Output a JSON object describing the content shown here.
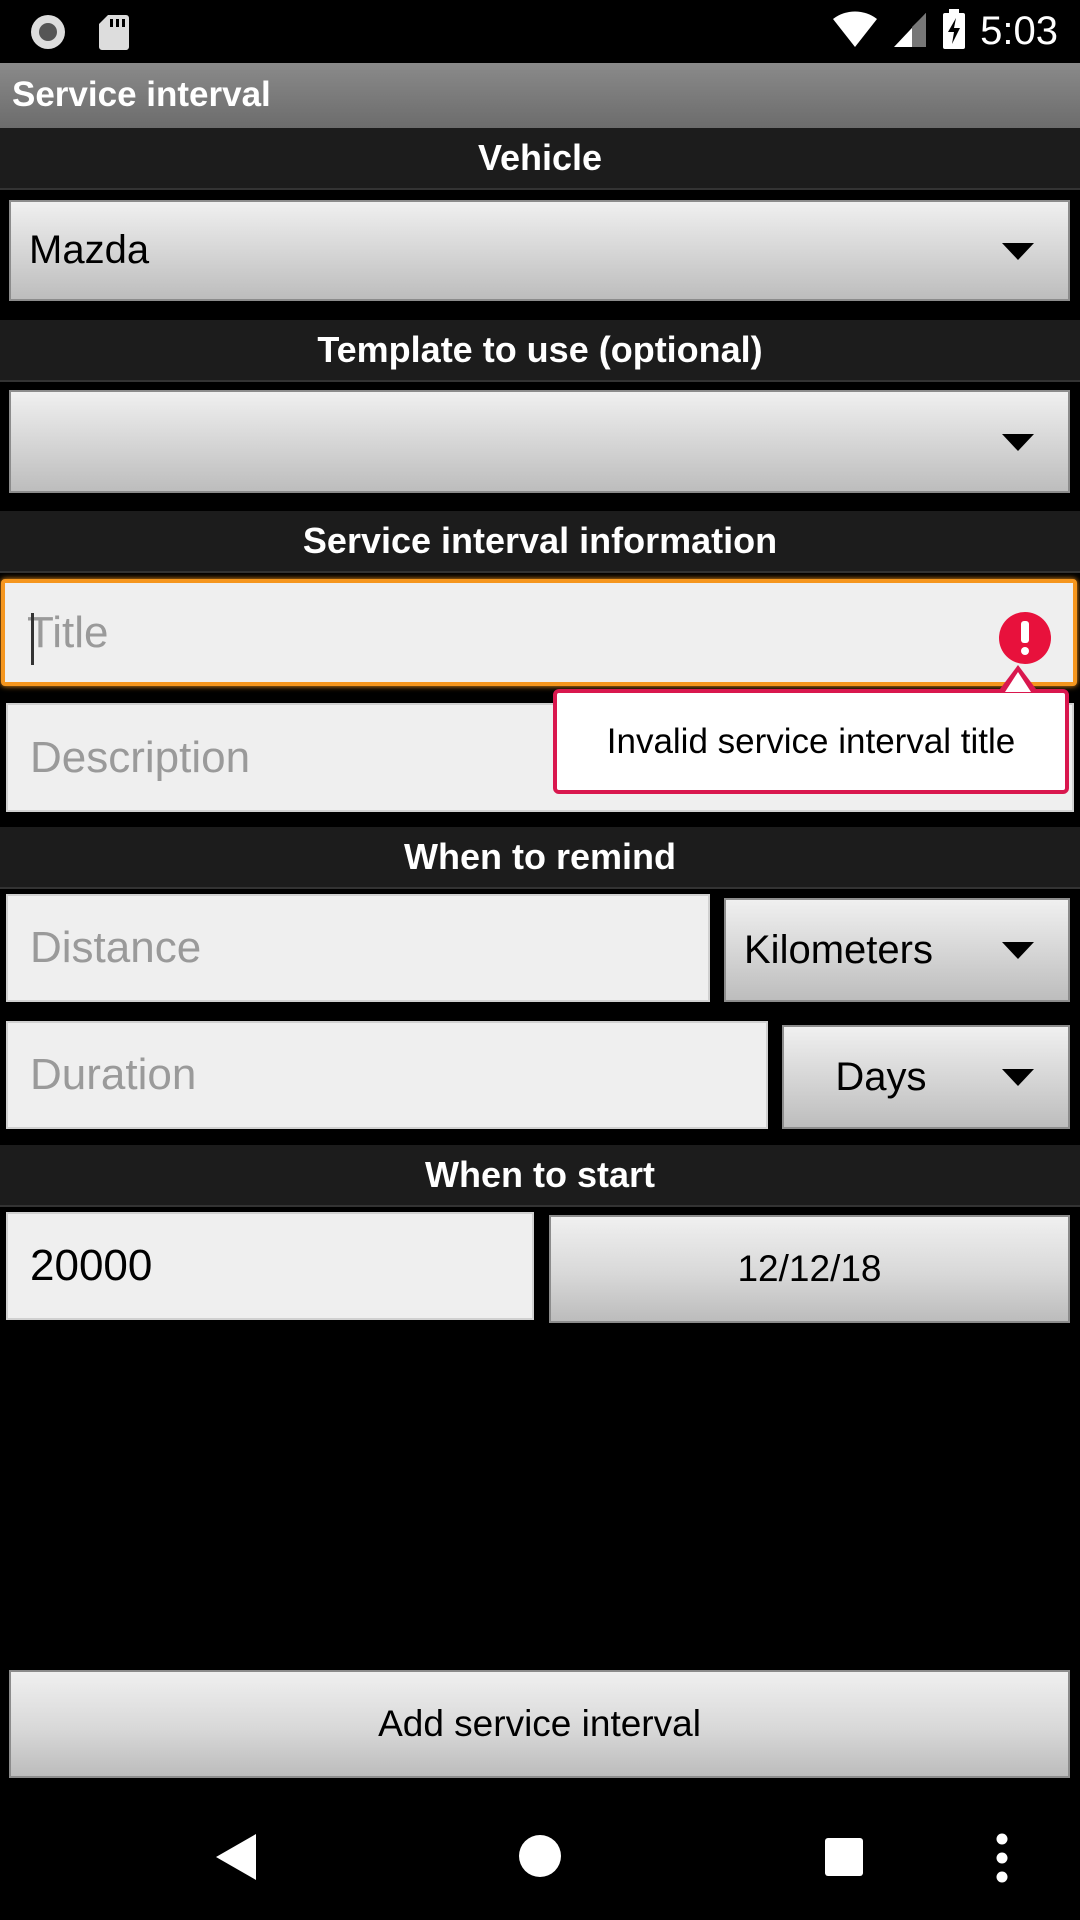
{
  "status_bar": {
    "time": "5:03",
    "icons": [
      "record-icon",
      "sd-card-icon",
      "wifi-icon",
      "signal-icon",
      "battery-charging-icon"
    ]
  },
  "app_bar": {
    "title": "Service interval"
  },
  "sections": {
    "vehicle": "Vehicle",
    "template": "Template to use (optional)",
    "info": "Service interval information",
    "remind": "When to remind",
    "start": "When to start"
  },
  "vehicle_spinner": {
    "value": "Mazda"
  },
  "template_spinner": {
    "value": ""
  },
  "title_field": {
    "placeholder": "Title",
    "value": ""
  },
  "description_field": {
    "placeholder": "Description",
    "value": ""
  },
  "error_tooltip": {
    "message": "Invalid service interval title",
    "color": "#d9174e"
  },
  "distance_field": {
    "placeholder": "Distance",
    "value": ""
  },
  "distance_unit": {
    "value": "Kilometers"
  },
  "duration_field": {
    "placeholder": "Duration",
    "value": ""
  },
  "duration_unit": {
    "value": "Days"
  },
  "start_odometer": {
    "value": "20000"
  },
  "start_date": {
    "label": "12/12/18"
  },
  "add_button": {
    "label": "Add service interval"
  },
  "nav_bar": {
    "icons": [
      "back-icon",
      "home-icon",
      "recents-icon",
      "overflow-menu-icon"
    ]
  },
  "colors": {
    "focus": "#f5961e",
    "error": "#e8113c",
    "section_bg": "#1c1c1c"
  }
}
